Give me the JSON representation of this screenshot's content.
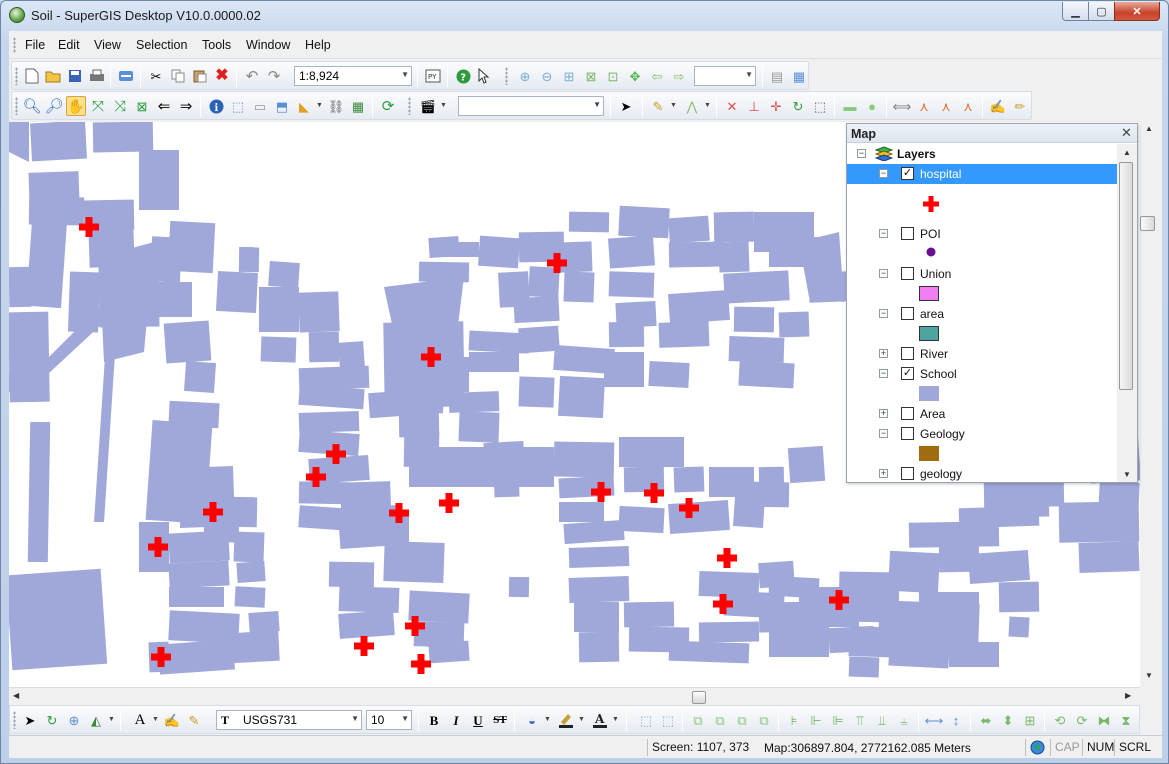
{
  "window": {
    "title": "Soil - SuperGIS Desktop V10.0.0000.02",
    "min_glyph": "▁",
    "max_glyph": "▢",
    "close_glyph": "✕"
  },
  "menu": [
    "File",
    "Edit",
    "View",
    "Selection",
    "Tools",
    "Window",
    "Help"
  ],
  "toolbar": {
    "scale": "1:8,924",
    "zoom_combo": "",
    "layer_combo": ""
  },
  "toc": {
    "title": "Map",
    "close_glyph": "✕",
    "root_label": "Layers",
    "layers": [
      {
        "name": "hospital",
        "checked": true,
        "expanded": true,
        "selected": true,
        "symbol": "red-cross"
      },
      {
        "name": "POI",
        "checked": false,
        "expanded": true,
        "symbol": "purple-dot"
      },
      {
        "name": "Union",
        "checked": false,
        "expanded": true,
        "symbol": "pink-square"
      },
      {
        "name": "area",
        "checked": false,
        "expanded": true,
        "symbol": "teal-square"
      },
      {
        "name": "River",
        "checked": false,
        "expanded": false
      },
      {
        "name": "School",
        "checked": true,
        "expanded": true,
        "symbol": "blue-square"
      },
      {
        "name": "Area",
        "checked": false,
        "expanded": false
      },
      {
        "name": "Geology",
        "checked": false,
        "expanded": true,
        "symbol": "brown-square"
      },
      {
        "name": "geology",
        "checked": false,
        "expanded": false
      }
    ],
    "expand_glyph": "+",
    "collapse_glyph": "−",
    "check_glyph": "✓"
  },
  "drawbar": {
    "font": "USGS731",
    "size": "10",
    "bold": "B",
    "italic": "I",
    "underline": "U",
    "strike": "ST"
  },
  "status": {
    "screen": "Screen: 1107, 373",
    "map": "Map:306897.804, 2772162.085 Meters",
    "cap": "CAP",
    "num": "NUM",
    "scrl": "SCRL"
  },
  "colors": {
    "parcel": "#9fa8d8",
    "hospital": "#ff0000",
    "selection": "#3399ff",
    "poi": "#6a0f8e",
    "union": "#f27ff2",
    "area": "#4fa3a0",
    "school": "#9fa8d8",
    "geology": "#a06c10"
  }
}
